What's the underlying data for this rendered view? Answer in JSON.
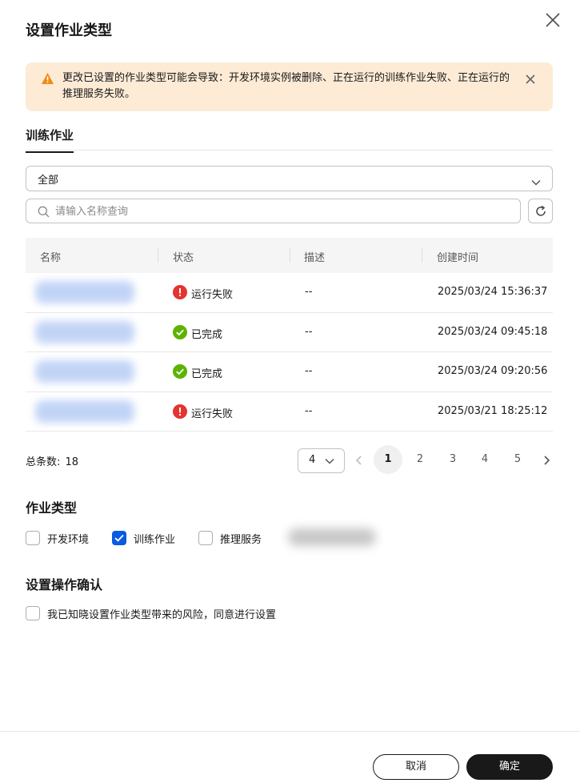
{
  "dialog": {
    "title": "设置作业类型"
  },
  "alert": {
    "message": "更改已设置的作业类型可能会导致：开发环境实例被删除、正在运行的训练作业失败、正在运行的推理服务失败。"
  },
  "tabs": [
    {
      "label": "训练作业",
      "active": true
    }
  ],
  "filter": {
    "selected": "全部"
  },
  "search": {
    "placeholder": "请输入名称查询",
    "value": ""
  },
  "table": {
    "columns": [
      "名称",
      "状态",
      "描述",
      "创建时间"
    ],
    "rows": [
      {
        "status": "运行失败",
        "status_icon": "error-icon",
        "description": "--",
        "created": "2025/03/24 15:36:37"
      },
      {
        "status": "已完成",
        "status_icon": "success-icon",
        "description": "--",
        "created": "2025/03/24 09:45:18"
      },
      {
        "status": "已完成",
        "status_icon": "success-icon",
        "description": "--",
        "created": "2025/03/24 09:20:56"
      },
      {
        "status": "运行失败",
        "status_icon": "error-icon",
        "description": "--",
        "created": "2025/03/21 18:25:12"
      }
    ]
  },
  "pagination": {
    "total_label": "总条数:",
    "total": "18",
    "page_size": "4",
    "pages": [
      "1",
      "2",
      "3",
      "4",
      "5"
    ],
    "current": "1"
  },
  "job_type": {
    "title": "作业类型",
    "options": [
      {
        "label": "开发环境",
        "checked": false
      },
      {
        "label": "训练作业",
        "checked": true
      },
      {
        "label": "推理服务",
        "checked": false
      }
    ]
  },
  "confirm": {
    "title": "设置操作确认",
    "label": "我已知晓设置作业类型带来的风险，同意进行设置",
    "checked": false
  },
  "footer": {
    "cancel": "取消",
    "ok": "确定"
  },
  "colors": {
    "primary": "#191919",
    "checkbox_checked": "#0a5be0",
    "alert_bg": "#fdebd6",
    "warning": "#f08a12",
    "error": "#e5332f",
    "success": "#5cb300"
  }
}
